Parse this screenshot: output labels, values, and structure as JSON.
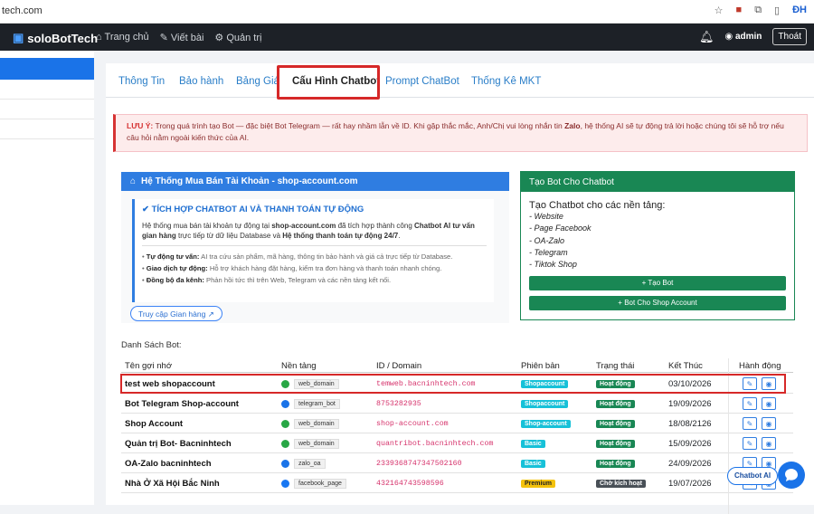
{
  "browser": {
    "url": "tech.com",
    "profile": "ĐH"
  },
  "navbar": {
    "brand": "soloBotTech",
    "links": [
      "Trang chủ",
      "Viết bài",
      "Quản trị"
    ],
    "user": "admin",
    "logout": "Thoát"
  },
  "tabs": [
    "Thông Tin",
    "Bảo hành",
    "Bảng Giá",
    "Cấu Hình Chatbot",
    "Prompt ChatBot",
    "Thống Kê MKT"
  ],
  "active_tab": "Cấu Hình Chatbot",
  "alert": {
    "label": "LƯU Ý:",
    "text1": " Trong quá trình tạo Bot — đặc biệt Bot Telegram — rất hay nhầm lẫn về ID. Khi gặp thắc mắc, Anh/Chị vui lòng nhắn tin ",
    "zalo": "Zalo",
    "text2": ", hệ thống AI sẽ tự động trả lời hoặc chúng tôi sẽ hỗ trợ nếu câu hỏi nằm ngoài kiến thức của AI."
  },
  "shop_card": {
    "header": "Hệ Thống Mua Bán Tài Khoản - shop-account.com",
    "title": "TÍCH HỢP CHATBOT AI VÀ THANH TOÁN TỰ ĐỘNG",
    "p1": "Hệ thống mua bán tài khoản tự động tại ",
    "site": "shop-account.com",
    "p2": " đã tích hợp thành công ",
    "b1": "Chatbot AI tư vấn gian hàng",
    "p3": " trực tiếp từ dữ liệu Database và ",
    "b2": "Hệ thống thanh toán tự động 24/7",
    "p4": ".",
    "features": [
      {
        "k": "Tự động tư vấn:",
        "v": " AI tra cứu sản phẩm, mã hàng, thông tin bảo hành và giá cả trực tiếp từ Database."
      },
      {
        "k": "Giao dịch tự động:",
        "v": " Hỗ trợ khách hàng đặt hàng, kiểm tra đơn hàng và thanh toán nhanh chóng."
      },
      {
        "k": "Đồng bộ đa kênh:",
        "v": " Phản hồi tức thì trên Web, Telegram và các nền tảng kết nối."
      }
    ],
    "button": "Truy cập Gian hàng"
  },
  "create_card": {
    "header": "Tạo Bot Cho Chatbot",
    "title": "Tạo Chatbot cho các nền tảng:",
    "items": [
      "- Website",
      "- Page Facebook",
      "- OA-Zalo",
      "- Telegram",
      "- Tiktok Shop"
    ],
    "btn1": "+ Tạo Bot",
    "btn2": "+ Bot Cho Shop Account"
  },
  "list_label": "Danh Sách Bot:",
  "table": {
    "headers": [
      "Tên gợi nhớ",
      "Nền tảng",
      "ID / Domain",
      "Phiên bản",
      "Trạng thái",
      "Kết Thúc",
      "Hành động"
    ],
    "rows": [
      {
        "name": "test web shopaccount",
        "platform": "web_domain",
        "id": "temweb.bacninhtech.com",
        "version": "Shopaccount",
        "status": "Hoạt động",
        "end": "03/10/2026"
      },
      {
        "name": "Bot Telegram Shop-account",
        "platform": "telegram_bot",
        "id": "8753282935",
        "version": "Shopaccount",
        "status": "Hoạt động",
        "end": "19/09/2026"
      },
      {
        "name": "Shop Account",
        "platform": "web_domain",
        "id": "shop-account.com",
        "version": "Shop-account",
        "status": "Hoạt động",
        "end": "18/08/2126"
      },
      {
        "name": "Quản trị Bot- Bacninhtech",
        "platform": "web_domain",
        "id": "quantribot.bacninhtech.com",
        "version": "Basic",
        "status": "Hoạt động",
        "end": "15/09/2026"
      },
      {
        "name": "OA-Zalo bacninhtech",
        "platform": "zalo_oa",
        "id": "2339368747347502160",
        "version": "Basic",
        "status": "Hoạt động",
        "end": "24/09/2026"
      },
      {
        "name": "Nhà Ở Xã Hội Bắc Ninh",
        "platform": "facebook_page",
        "id": "432164743598596",
        "version": "Premium",
        "status": "Chờ kích hoạt",
        "end": "19/07/2026"
      }
    ]
  },
  "chat": {
    "label": "Chatbot AI"
  },
  "colors": {
    "web": "#28a745",
    "telegram": "#1a73e8",
    "zalo": "#1a73e8",
    "facebook": "#1877f2",
    "shopaccount": "#17c1d8",
    "basic": "#17c1d8",
    "premium": "#f4c20d"
  }
}
